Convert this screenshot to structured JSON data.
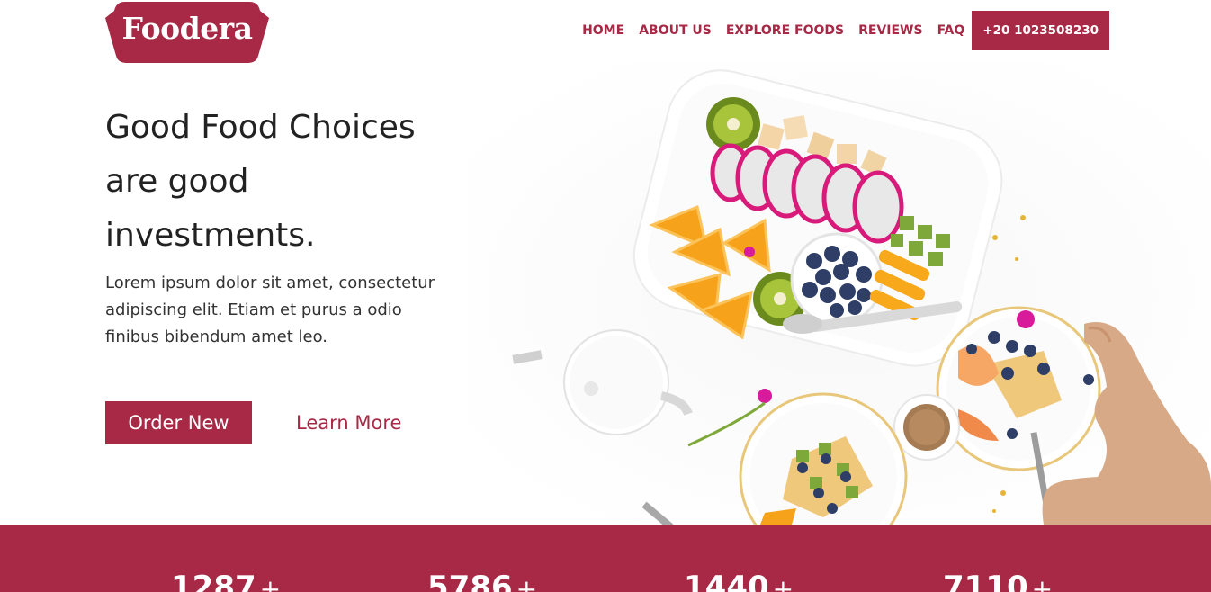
{
  "brand": {
    "name": "Foodera",
    "color": "#a72946"
  },
  "nav": {
    "items": [
      "HOME",
      "ABOUT US",
      "EXPLORE FOODS",
      "REVIEWS",
      "FAQ"
    ],
    "phone": "+20 1023508230"
  },
  "hero": {
    "title_line1": "Good Food Choices",
    "title_line2": "are good",
    "title_line3": "investments.",
    "description": "Lorem ipsum dolor sit amet, consectetur adipiscing elit. Etiam et purus a odio finibus bibendum amet leo.",
    "order_label": "Order New",
    "learn_label": "Learn More",
    "image_icon": "food-table-photo"
  },
  "stats": [
    {
      "value": "1287",
      "suffix": "+"
    },
    {
      "value": "5786",
      "suffix": "+"
    },
    {
      "value": "1440",
      "suffix": "+"
    },
    {
      "value": "7110",
      "suffix": "+"
    }
  ]
}
